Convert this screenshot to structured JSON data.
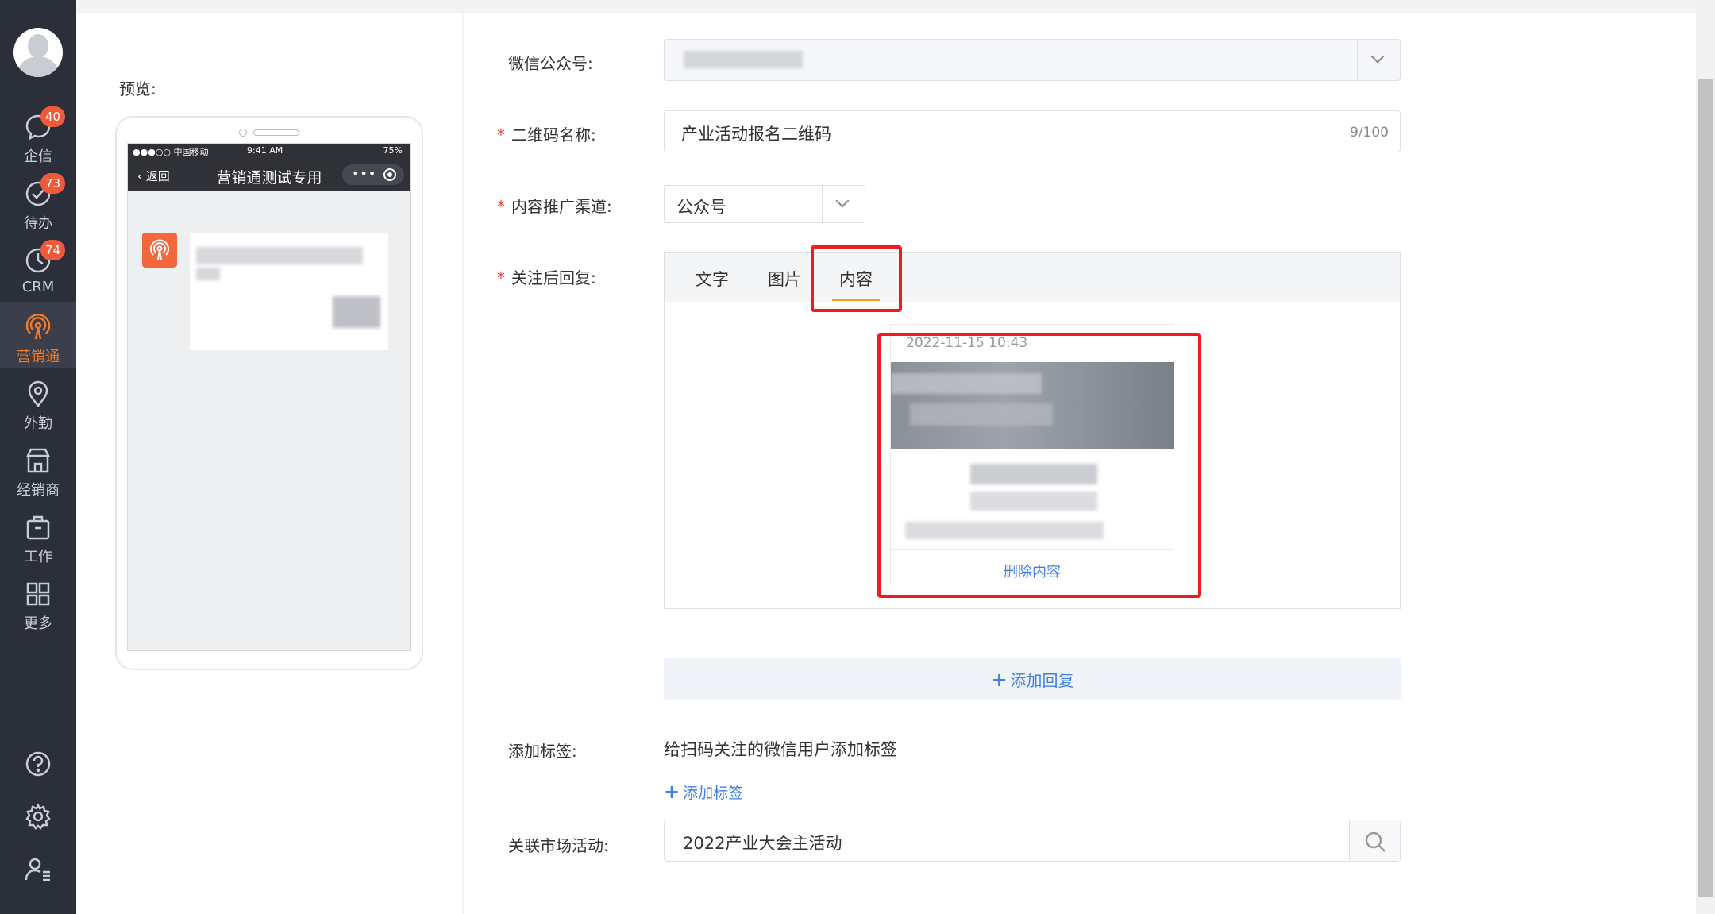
{
  "sidebar": {
    "items": [
      {
        "label": "企信",
        "badge": "40",
        "icon": "chat-icon"
      },
      {
        "label": "待办",
        "badge": "73",
        "icon": "check-circle-icon"
      },
      {
        "label": "CRM",
        "badge": "74",
        "icon": "clock-icon"
      },
      {
        "label": "营销通",
        "badge": "",
        "icon": "broadcast-icon",
        "active": true
      },
      {
        "label": "外勤",
        "badge": "",
        "icon": "location-pin-icon"
      },
      {
        "label": "经销商",
        "badge": "",
        "icon": "store-icon"
      },
      {
        "label": "工作",
        "badge": "",
        "icon": "briefcase-icon"
      },
      {
        "label": "更多",
        "badge": "",
        "icon": "grid-icon"
      }
    ],
    "utilities": [
      "help-icon",
      "settings-icon",
      "user-settings-icon"
    ]
  },
  "preview": {
    "label": "预览:",
    "status_left": "●●●○○ 中国移动",
    "status_time": "9:41 AM",
    "status_battery": "75%",
    "back_label": "返回",
    "title": "营销通测试专用"
  },
  "form": {
    "wechat_account": {
      "label": "微信公众号:"
    },
    "qr_name": {
      "label": "二维码名称:",
      "value": "产业活动报名二维码",
      "count": "9/100"
    },
    "channel": {
      "label": "内容推广渠道:",
      "value": "公众号"
    },
    "reply": {
      "label": "关注后回复:",
      "tabs": [
        "文字",
        "图片",
        "内容"
      ],
      "active_tab": "内容",
      "card_date": "2022-11-15 10:43",
      "delete_label": "删除内容"
    },
    "add_reply_label": "添加回复",
    "tags": {
      "label": "添加标签:",
      "hint": "给扫码关注的微信用户添加标签",
      "add_label": "添加标签"
    },
    "activity": {
      "label": "关联市场活动:",
      "value": "2022产业大会主活动"
    }
  },
  "colors": {
    "sidebar_bg": "#2b2f3a",
    "accent_orange": "#f47a28",
    "link_blue": "#3f7fe8",
    "highlight_red": "#ee1c1c",
    "badge_red": "#f05a3a"
  }
}
